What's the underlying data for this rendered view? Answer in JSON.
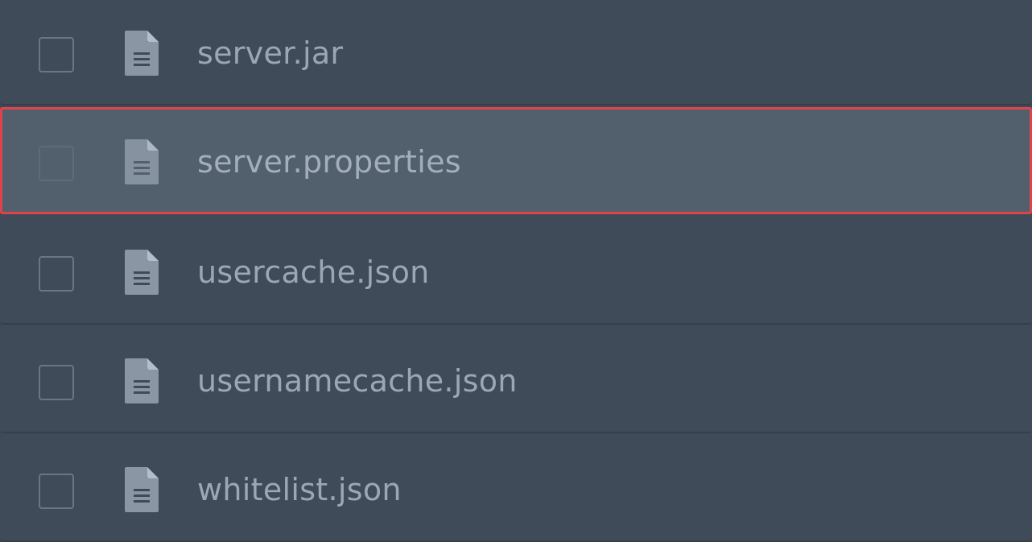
{
  "files": [
    {
      "name": "server.jar",
      "icon": "file-text-icon",
      "checked": false,
      "highlighted": false
    },
    {
      "name": "server.properties",
      "icon": "file-text-icon",
      "checked": false,
      "highlighted": true
    },
    {
      "name": "usercache.json",
      "icon": "file-text-icon",
      "checked": false,
      "highlighted": false
    },
    {
      "name": "usernamecache.json",
      "icon": "file-text-icon",
      "checked": false,
      "highlighted": false
    },
    {
      "name": "whitelist.json",
      "icon": "file-text-icon",
      "checked": false,
      "highlighted": false
    }
  ],
  "colors": {
    "background": "#3f4a57",
    "row_highlight": "#525f6d",
    "highlight_border": "#e0434a",
    "text": "#9ba7b3",
    "icon": "#8a96a3"
  }
}
